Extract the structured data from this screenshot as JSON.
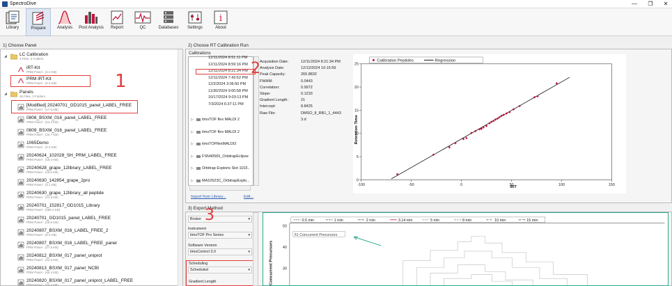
{
  "app": {
    "title": "SpectroDive"
  },
  "window": {
    "minimize": "—",
    "restore": "❐",
    "close": "✕"
  },
  "toolbar": {
    "items": [
      {
        "label": "Library",
        "icon": "library-icon"
      },
      {
        "label": "Prepare",
        "icon": "prepare-icon"
      },
      {
        "label": "Analysis",
        "icon": "analysis-icon"
      },
      {
        "label": "Post Analysis",
        "icon": "post-analysis-icon"
      },
      {
        "label": "Report",
        "icon": "report-icon"
      },
      {
        "label": "QC",
        "icon": "qc-icon"
      },
      {
        "label": "Databases",
        "icon": "databases-icon"
      },
      {
        "label": "Settings",
        "icon": "settings-icon"
      },
      {
        "label": "About",
        "icon": "about-icon"
      }
    ]
  },
  "left_panel": {
    "title": "1) Choose Panel",
    "lc_group": {
      "name": "LC Calibration",
      "sub": "2 Files, 2 Folders"
    },
    "lc_items": [
      {
        "name": "iRT-Kit",
        "sub": "PRM Panel - (2.2 KB)"
      },
      {
        "name": "PRM iRT-Kit",
        "sub": "PRM Panel - (2.3 KB)"
      }
    ],
    "panels_group": {
      "name": "Panels",
      "sub": "45 Files, 3 Folders"
    },
    "panel_items": [
      {
        "name": "[Modified] 20240701_GD1015_panel_LABEL_FREE",
        "sub": "PRM Panel - (17.6 KB)"
      },
      {
        "name": "0808_BSXM_016_panel_LABEL_FREE",
        "sub": "PRM Panel - (24.3 KB)"
      },
      {
        "name": "0809_BSXM_016_panel_LABEL_FREE",
        "sub": "PRM Panel - (23.7 KB)"
      },
      {
        "name": "1065Demo",
        "sub": "PRM Panel - (2.3 KB)"
      },
      {
        "name": "20240624_102028_SH_PRM_LABEL_FREE",
        "sub": "PRM Panel - (16.4 KB)"
      },
      {
        "name": "20240628_grape_12library_LABEL_FREE",
        "sub": "PRM Panel - (18.0 KB)"
      },
      {
        "name": "20240630_142854_grape_2pro",
        "sub": "PRM Panel - (3.1 KB)"
      },
      {
        "name": "20240630_grape_12library_all peptide",
        "sub": "PRM Panel - (21.8 KB)"
      },
      {
        "name": "20240701_152817_GD1015_Library",
        "sub": "PRM Panel - (256.4 KB)"
      },
      {
        "name": "20240701_GD1015_panel_LABEL_FREE",
        "sub": "PRM Panel - (26.6 KB)"
      },
      {
        "name": "20240807_BSXM_016_LABEL_FREE_2",
        "sub": "PRM Panel - (8.2 KB)"
      },
      {
        "name": "20240807_BSXM_016_LABEL_FREE_panel",
        "sub": "PRM Panel - (27.6 KB)"
      },
      {
        "name": "20240812_BSXM_017_panel_uniprot",
        "sub": "PRM Panel - (44.3 KB)"
      },
      {
        "name": "20240813_BSXM_017_panel_NCBI",
        "sub": "PRM Panel - (40.4 KB)"
      },
      {
        "name": "20240820_BSXM_017_panel_uniprot_LABEL_FREE",
        "sub": "PRM Panel - (44.2 KB)"
      }
    ]
  },
  "calibration": {
    "title": "2) Choose RT Calibration Run",
    "list_label": "Calibrations",
    "runs": [
      {
        "text": "12/11/2024 8:51:11 PM"
      },
      {
        "text": "12/11/2024 8:59:16 PM"
      },
      {
        "text": "12/11/2024 8:21:34 PM"
      },
      {
        "text": "12/11/2024 7:43:52 PM"
      },
      {
        "text": "12/2/2024 3:06:50 PM"
      },
      {
        "text": "11/30/2024 9:00:58 PM"
      },
      {
        "text": "10/17/2024 9:03:13 PM"
      },
      {
        "text": "7/3/2024 6:37:11 PM"
      }
    ],
    "instruments": [
      {
        "text": "timsTOF flex MALDI 2"
      },
      {
        "text": "timsTOF flex MALDI 2"
      },
      {
        "text": "timsTOFflexMALDI2"
      },
      {
        "text": "FSN40565_OrbitrapEclipse"
      },
      {
        "text": "Orbitrap Exploris Slot 1103..."
      },
      {
        "text": "MA10523C_OrbitrapExplo..."
      }
    ],
    "import_link": "Import from Library...",
    "edit_link": "Edit...",
    "info": [
      {
        "k": "Acquisition Date:",
        "v": "12/11/2024 8:21:34 PM"
      },
      {
        "k": "Analysis Date:",
        "v": "12/12/2024 10:15:59"
      },
      {
        "k": "Peak Capacity:",
        "v": "265.8832"
      },
      {
        "k": "FWHM:",
        "v": "0.0443"
      },
      {
        "k": "Correlation:",
        "v": "0.9972"
      },
      {
        "k": "Slope:",
        "v": "0.1233"
      },
      {
        "k": "Gradient Length:",
        "v": "21"
      },
      {
        "k": "Intercept:",
        "v": "8.8425"
      },
      {
        "k": "Raw File:",
        "v": "DMSO_8_RB1_1_4443"
      },
      {
        "k": "",
        "v": "3.d"
      }
    ]
  },
  "chart_data": {
    "type": "scatter",
    "legend": [
      "Calibration Peptides",
      "Regression"
    ],
    "legend_position": "top",
    "xlabel": "iRT",
    "ylabel": "Retention Time",
    "xlim": [
      -100,
      150
    ],
    "ylim": [
      0,
      25
    ],
    "xticks": [
      -100,
      -50,
      0,
      50,
      100,
      150
    ],
    "yticks": [
      0,
      5,
      10,
      15,
      20,
      25
    ],
    "regression": {
      "x": [
        -70,
        108
      ],
      "y": [
        0.2,
        22.1
      ]
    },
    "points": [
      {
        "x": -64,
        "y": 1.2
      },
      {
        "x": -28,
        "y": 5.4
      },
      {
        "x": -12,
        "y": 7.0
      },
      {
        "x": -6,
        "y": 7.9
      },
      {
        "x": 2,
        "y": 8.8
      },
      {
        "x": 5,
        "y": 9.0
      },
      {
        "x": 10,
        "y": 10.1
      },
      {
        "x": 14,
        "y": 10.5
      },
      {
        "x": 18,
        "y": 10.9
      },
      {
        "x": 20,
        "y": 11.0
      },
      {
        "x": 22,
        "y": 11.3
      },
      {
        "x": 25,
        "y": 11.6
      },
      {
        "x": 28,
        "y": 12.2
      },
      {
        "x": 30,
        "y": 12.5
      },
      {
        "x": 32,
        "y": 12.7
      },
      {
        "x": 34,
        "y": 13.0
      },
      {
        "x": 36,
        "y": 13.2
      },
      {
        "x": 38,
        "y": 13.5
      },
      {
        "x": 40,
        "y": 13.8
      },
      {
        "x": 42,
        "y": 14.0
      },
      {
        "x": 45,
        "y": 14.3
      },
      {
        "x": 48,
        "y": 14.6
      },
      {
        "x": 52,
        "y": 15.2
      },
      {
        "x": 58,
        "y": 15.9
      },
      {
        "x": 73,
        "y": 17.8
      },
      {
        "x": 76,
        "y": 18.0
      },
      {
        "x": 95,
        "y": 20.8
      }
    ]
  },
  "export": {
    "title": "3) Export Method",
    "vendor_value": "Bruker",
    "instrument_label": "Instrument",
    "instrument_value": "timsTOF Pro Series",
    "software_label": "Software Version",
    "software_value": "timsControl 3.0",
    "scheduling_label": "Scheduling",
    "scheduling_value": "Scheduled",
    "gradient_label": "Gradient Length"
  },
  "concurrent_chart": {
    "legend": [
      "0.5 min",
      "1 min",
      "2 min",
      "3.14 min",
      "5 min",
      "8 min",
      "10 min",
      "15 min"
    ],
    "annotation": "51 Concurrent Precursors",
    "ylabel": "Concurrent Precursors",
    "yticks": [
      50,
      40,
      30
    ]
  },
  "annotations": {
    "one": "1",
    "two": "2",
    "three": "3"
  },
  "colors": {
    "highlight_red": "#e23b3b",
    "point": "#c0143c",
    "teal_border": "#2aa88a"
  }
}
